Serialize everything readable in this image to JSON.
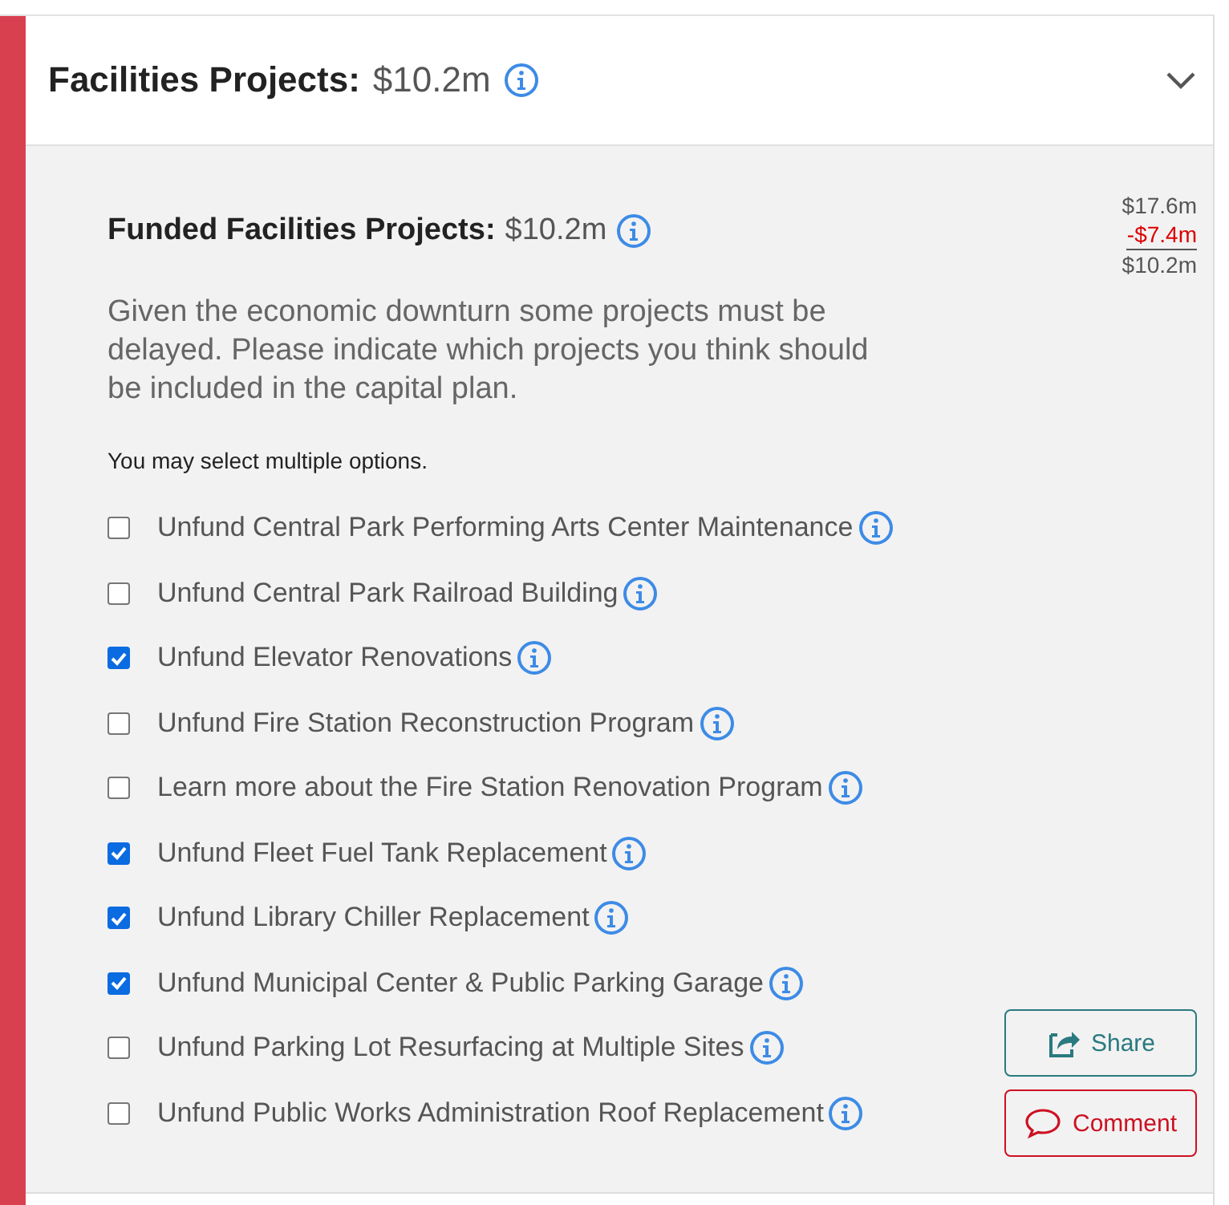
{
  "section": {
    "title": "Facilities Projects:",
    "amount": "$10.2m",
    "expanded": true
  },
  "funded": {
    "title": "Funded Facilities Projects:",
    "amount": "$10.2m"
  },
  "totals": {
    "original": "$17.6m",
    "change": "-$7.4m",
    "result": "$10.2m"
  },
  "prompt": "Given the economic downturn some projects must be delayed. Please indicate which projects you think should be included in the capital plan.",
  "hint": "You may select multiple options.",
  "options": [
    {
      "label": "Unfund Central Park Performing Arts Center Maintenance",
      "checked": false
    },
    {
      "label": "Unfund Central Park Railroad Building",
      "checked": false
    },
    {
      "label": "Unfund Elevator Renovations",
      "checked": true
    },
    {
      "label": "Unfund Fire Station Reconstruction Program",
      "checked": false
    },
    {
      "label": "Learn more about the Fire Station Renovation Program",
      "checked": false
    },
    {
      "label": "Unfund Fleet Fuel Tank Replacement",
      "checked": true
    },
    {
      "label": "Unfund Library Chiller Replacement",
      "checked": true
    },
    {
      "label": "Unfund Municipal Center & Public Parking Garage",
      "checked": true
    },
    {
      "label": "Unfund Parking Lot Resurfacing at Multiple Sites",
      "checked": false
    },
    {
      "label": "Unfund Public Works Administration Roof Replacement",
      "checked": false
    }
  ],
  "buttons": [
    {
      "kind": "share",
      "label": "Share"
    },
    {
      "kind": "comment",
      "label": "Comment"
    }
  ]
}
